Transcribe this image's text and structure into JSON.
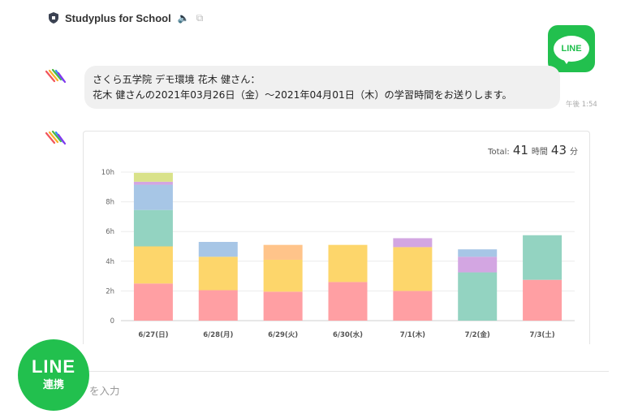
{
  "header": {
    "app_name": "Studyplus for School"
  },
  "line_logo": {
    "text": "LINE",
    "color": "#22c04e"
  },
  "message": {
    "line1": "さくら五学院 デモ環境 花木 健さん：",
    "line2": "花木 健さんの2021年03月26日（金）〜2021年04月01日（木）の学習時間をお送りします。",
    "time": "午後 1:54"
  },
  "total": {
    "label": "Total:",
    "hours": "41",
    "hours_unit": "時間",
    "minutes": "43",
    "minutes_unit": "分"
  },
  "chart_data": {
    "type": "bar",
    "stacked": true,
    "ylim": [
      0,
      10
    ],
    "y_ticks": [
      "0",
      "2h",
      "4h",
      "6h",
      "8h",
      "10h"
    ],
    "grid": true,
    "categories": [
      "6/27(日)",
      "6/28(月)",
      "6/29(火)",
      "6/30(水)",
      "7/1(木)",
      "7/2(金)",
      "7/3(土)"
    ],
    "colors": [
      "#ff9fa3",
      "#fdd66b",
      "#93d3c1",
      "#a7c6e6",
      "#ffc48a",
      "#d3a6e2",
      "#d9e28a"
    ],
    "bars": [
      [
        {
          "value": 2.5,
          "color": "#ff9fa3"
        },
        {
          "value": 2.5,
          "color": "#fdd66b"
        },
        {
          "value": 2.45,
          "color": "#93d3c1"
        },
        {
          "value": 1.7,
          "color": "#a7c6e6"
        },
        {
          "value": 0.2,
          "color": "#d3a6e2"
        },
        {
          "value": 0.6,
          "color": "#d9e28a"
        }
      ],
      [
        {
          "value": 2.05,
          "color": "#ff9fa3"
        },
        {
          "value": 2.25,
          "color": "#fdd66b"
        },
        {
          "value": 1.0,
          "color": "#a7c6e6"
        }
      ],
      [
        {
          "value": 1.95,
          "color": "#ff9fa3"
        },
        {
          "value": 2.15,
          "color": "#fdd66b"
        },
        {
          "value": 1.0,
          "color": "#ffc48a"
        }
      ],
      [
        {
          "value": 2.6,
          "color": "#ff9fa3"
        },
        {
          "value": 2.5,
          "color": "#fdd66b"
        }
      ],
      [
        {
          "value": 2.0,
          "color": "#ff9fa3"
        },
        {
          "value": 2.95,
          "color": "#fdd66b"
        },
        {
          "value": 0.6,
          "color": "#d3a6e2"
        }
      ],
      [
        {
          "value": 3.25,
          "color": "#93d3c1"
        },
        {
          "value": 1.05,
          "color": "#d3a6e2"
        },
        {
          "value": 0.5,
          "color": "#a7c6e6"
        }
      ],
      [
        {
          "value": 2.75,
          "color": "#ff9fa3"
        },
        {
          "value": 3.0,
          "color": "#93d3c1"
        }
      ]
    ]
  },
  "line_button": {
    "line1": "LINE",
    "line2": "連携"
  },
  "input": {
    "placeholder_visible": "を入力"
  }
}
